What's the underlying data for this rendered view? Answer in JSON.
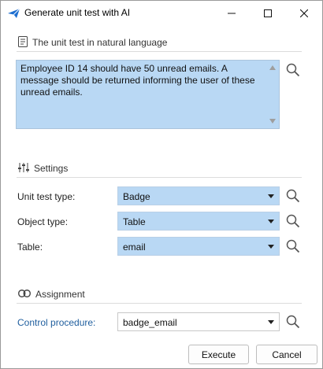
{
  "window": {
    "title": "Generate unit test with AI"
  },
  "natural_language": {
    "header": "The unit test in natural language",
    "text": "Employee ID 14 should have 50 unread emails. A message should be returned informing the user of these unread emails."
  },
  "settings": {
    "header": "Settings",
    "fields": [
      {
        "label": "Unit test type:",
        "value": "Badge"
      },
      {
        "label": "Object type:",
        "value": "Table"
      },
      {
        "label": "Table:",
        "value": "email"
      }
    ]
  },
  "assignment": {
    "header": "Assignment",
    "control_procedure_label": "Control procedure:",
    "control_procedure_value": "badge_email"
  },
  "buttons": {
    "execute": "Execute",
    "cancel": "Cancel"
  },
  "colors": {
    "field_highlight": "#b9d8f4",
    "link": "#1f5e9e",
    "accent_icon": "#1e6fd0"
  }
}
